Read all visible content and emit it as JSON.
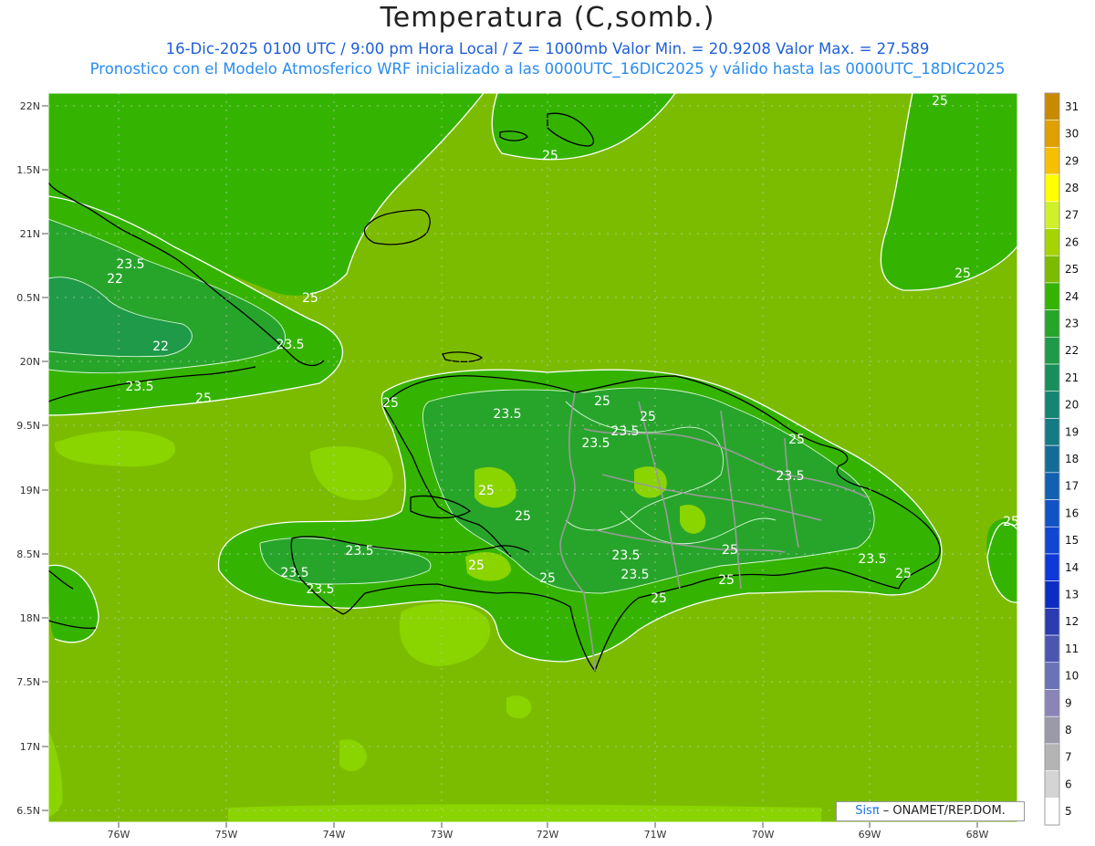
{
  "header": {
    "title": "Temperatura (C,somb.)",
    "subtitle_line1": "16-Dic-2025  0100 UTC / 9:00 pm Hora Local / Z = 1000mb    Valor Min. = 20.9208  Valor Max. = 27.589",
    "subtitle_line2": "Pronostico con el Modelo Atmosferico WRF inicializado a las 0000UTC_16DIC2025 y válido hasta las  0000UTC_18DIC2025"
  },
  "axes": {
    "lat_labels": [
      "22N",
      "1.5N",
      "21N",
      "0.5N",
      "20N",
      "9.5N",
      "19N",
      "8.5N",
      "18N",
      "7.5N",
      "17N",
      "6.5N"
    ],
    "lon_labels": [
      "76W",
      "75W",
      "74W",
      "73W",
      "72W",
      "71W",
      "70W",
      "69W",
      "68W"
    ]
  },
  "contour_labels": [
    "25",
    "25",
    "25",
    "25",
    "23.5",
    "22",
    "22",
    "23.5",
    "23.5",
    "25",
    "25",
    "23.5",
    "25",
    "23.5",
    "25",
    "23.5",
    "25",
    "23.5",
    "25",
    "25",
    "23.5",
    "23.5",
    "23.5",
    "25",
    "23.5",
    "23.5",
    "25",
    "25",
    "25",
    "25",
    "23.5",
    "25"
  ],
  "colorbar": {
    "levels": [
      "31",
      "30",
      "29",
      "28",
      "27",
      "26",
      "25",
      "24",
      "23",
      "22",
      "21",
      "20",
      "19",
      "18",
      "17",
      "16",
      "15",
      "14",
      "13",
      "12",
      "11",
      "10",
      "9",
      "8",
      "7",
      "6",
      "5"
    ],
    "colors": [
      "#c88a00",
      "#e0a000",
      "#f6c000",
      "#ffff00",
      "#cff02a",
      "#a6d400",
      "#7cbc00",
      "#34b400",
      "#27a52b",
      "#1f9a48",
      "#188e5c",
      "#158470",
      "#147a84",
      "#136c98",
      "#1260b0",
      "#1152c4",
      "#1046d4",
      "#0e38d8",
      "#0c2cc4",
      "#2a3cb0",
      "#4a56b0",
      "#6a72b8",
      "#8a84b8",
      "#9a9aa8",
      "#b4b4b4",
      "#d4d4d4",
      "#ffffff"
    ]
  },
  "field_colors": {
    "ocean": "#7cbc00",
    "warm": "#8ad400",
    "land": "#34b400",
    "cool": "#27a52b",
    "cold": "#1f9a48"
  },
  "footer": {
    "brand": "Sisπ",
    "text": " – ONAMET/REP.DOM."
  }
}
